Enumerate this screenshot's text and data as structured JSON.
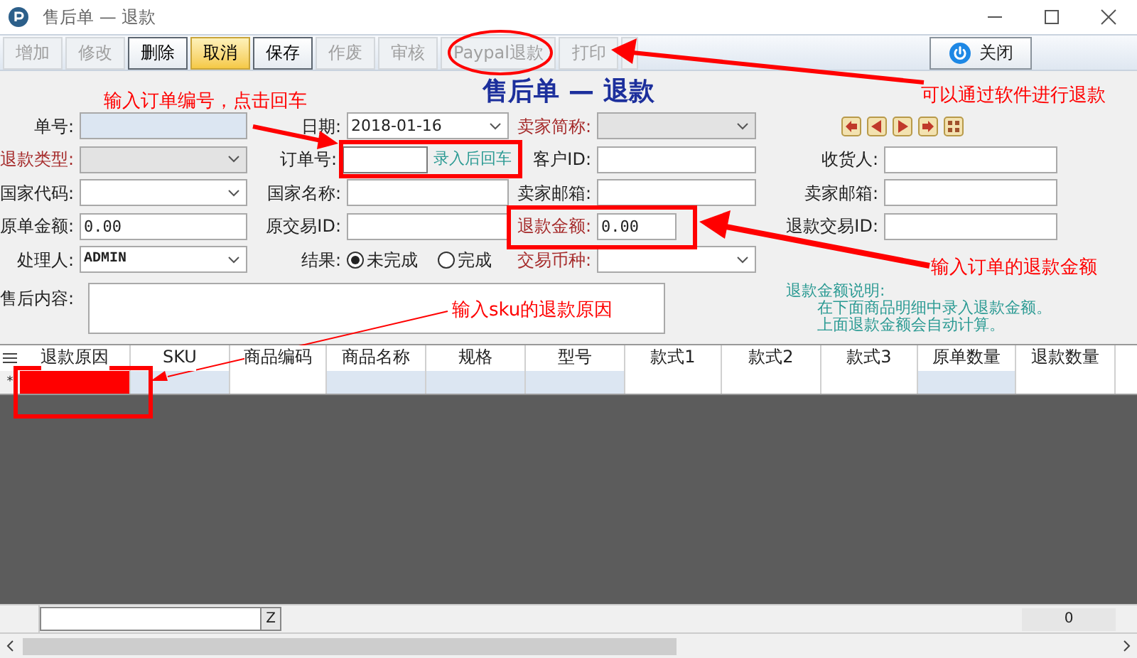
{
  "window": {
    "title": "售后单 — 退款"
  },
  "toolbar": {
    "buttons": [
      {
        "label": "增加",
        "disabled": true,
        "selected": false
      },
      {
        "label": "修改",
        "disabled": true,
        "selected": false
      },
      {
        "label": "删除",
        "disabled": false,
        "selected": false
      },
      {
        "label": "取消",
        "disabled": false,
        "selected": true
      },
      {
        "label": "保存",
        "disabled": false,
        "selected": false
      },
      {
        "label": "作废",
        "disabled": true,
        "selected": false
      },
      {
        "label": "审核",
        "disabled": true,
        "selected": false
      },
      {
        "label": "Paypal退款",
        "disabled": true,
        "selected": false
      },
      {
        "label": "打印",
        "disabled": true,
        "selected": false
      }
    ],
    "close_button": "关闭"
  },
  "heading": "售后单 — 退款",
  "form": {
    "rows": [
      [
        {
          "label": "单号:",
          "kind": "input",
          "required": false,
          "read_only": true
        },
        {
          "label": "日期:",
          "kind": "select",
          "required": false,
          "value": "2018-01-16"
        },
        {
          "label": "卖家简称:",
          "kind": "select",
          "required": true,
          "disabled": true
        }
      ],
      [
        {
          "label": "退款类型:",
          "kind": "select",
          "required": true,
          "disabled": true
        },
        {
          "label": "订单号:",
          "kind": "order",
          "required": false,
          "hint": "录入后回车"
        },
        {
          "label": "客户ID:",
          "kind": "input",
          "required": false
        },
        {
          "label": "收货人:",
          "kind": "input",
          "required": false
        }
      ],
      [
        {
          "label": "国家代码:",
          "kind": "select",
          "required": false
        },
        {
          "label": "国家名称:",
          "kind": "input",
          "required": false
        },
        {
          "label": "卖家邮箱:",
          "kind": "input",
          "required": false
        },
        {
          "label": "卖家邮箱:",
          "kind": "input",
          "required": false
        }
      ],
      [
        {
          "label": "原单金额:",
          "kind": "input",
          "required": false,
          "value": "0.00"
        },
        {
          "label": "原交易ID:",
          "kind": "input",
          "required": false
        },
        {
          "label": "退款金额:",
          "kind": "amount",
          "required": true,
          "value": "0.00"
        },
        {
          "label": "退款交易ID:",
          "kind": "input",
          "required": false
        }
      ],
      [
        {
          "label": "处理人:",
          "kind": "select",
          "required": false,
          "value": "ADMIN"
        },
        {
          "label": "结果:",
          "kind": "radio",
          "required": false,
          "options": [
            {
              "label": "未完成",
              "selected": true
            },
            {
              "label": "完成",
              "selected": false
            }
          ]
        },
        {
          "label": "交易币种:",
          "kind": "select",
          "required": true
        }
      ]
    ],
    "remarks_label": "售后内容:",
    "note": {
      "title": "退款金额说明:",
      "lines": [
        "在下面商品明细中录入退款金额。",
        "上面退款金额会自动计算。"
      ]
    }
  },
  "grid": {
    "columns": [
      {
        "label": "退款原因",
        "highlighted": true
      },
      {
        "label": "SKU",
        "shaded": true
      },
      {
        "label": "商品编码",
        "shaded": false
      },
      {
        "label": "商品名称",
        "shaded": true
      },
      {
        "label": "规格",
        "shaded": true
      },
      {
        "label": "型号",
        "shaded": true
      },
      {
        "label": "款式1",
        "shaded": false
      },
      {
        "label": "款式2",
        "shaded": false
      },
      {
        "label": "款式3",
        "shaded": false
      },
      {
        "label": "原单数量",
        "shaded": true
      },
      {
        "label": "退款数量",
        "shaded": false
      }
    ],
    "new_row_marker": "*"
  },
  "footer": {
    "filter_button": "Z",
    "total": "0"
  },
  "annotations": [
    {
      "text": "输入订单编号，点击回车"
    },
    {
      "text": "可以通过软件进行退款"
    },
    {
      "text": "输入订单的退款金额"
    },
    {
      "text": "输入sku的退款原因"
    }
  ]
}
